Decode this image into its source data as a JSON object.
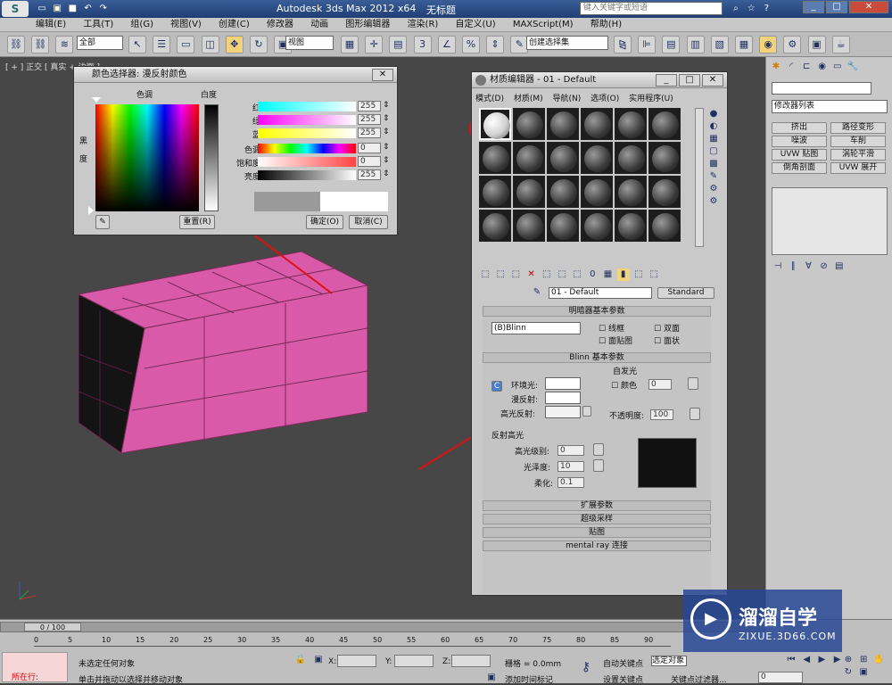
{
  "window": {
    "title": "Autodesk 3ds Max  2012 x64",
    "doc": "无标题",
    "search_placeholder": "键入关键字或短语"
  },
  "menu": [
    "编辑(E)",
    "工具(T)",
    "组(G)",
    "视图(V)",
    "创建(C)",
    "修改器",
    "动画",
    "图形编辑器",
    "渲染(R)",
    "自定义(U)",
    "MAXScript(M)",
    "帮助(H)"
  ],
  "toolbar": {
    "filter": "全部",
    "view": "视图",
    "snap_num": "3",
    "selection_set": "创建选择集"
  },
  "viewport": {
    "label": "[ + ] 正交 [ 真实 + 边面 ]"
  },
  "color_picker": {
    "title": "颜色选择器: 漫反射颜色",
    "hue_label": "色调",
    "white_label": "白度",
    "black_label": "黑",
    "degree_label": "度",
    "channels": [
      {
        "label": "红:",
        "value": "255"
      },
      {
        "label": "绿:",
        "value": "255"
      },
      {
        "label": "蓝:",
        "value": "255"
      },
      {
        "label": "色调:",
        "value": "0"
      },
      {
        "label": "饱和度:",
        "value": "0"
      },
      {
        "label": "亮度:",
        "value": "255"
      }
    ],
    "reset": "重置(R)",
    "ok": "确定(O)",
    "cancel": "取消(C)"
  },
  "material_editor": {
    "title": "材质编辑器 - 01 - Default",
    "menus": [
      "模式(D)",
      "材质(M)",
      "导航(N)",
      "选项(O)",
      "实用程序(U)"
    ],
    "material_name": "01 - Default",
    "material_type": "Standard",
    "shader_rollout": "明暗器基本参数",
    "shader": "(B)Blinn",
    "opt_wire": "线框",
    "opt_2side": "双面",
    "opt_facemap": "面贴图",
    "opt_faceted": "面状",
    "blinn_rollout": "Blinn 基本参数",
    "self_illum": "自发光",
    "ambient": "环境光:",
    "diffuse": "漫反射:",
    "specular": "高光反射:",
    "color_label": "颜色",
    "color_value": "0",
    "opacity_label": "不透明度:",
    "opacity_value": "100",
    "spec_group": "反射高光",
    "spec_level": "高光级别:",
    "spec_level_value": "0",
    "glossiness": "光泽度:",
    "glossiness_value": "10",
    "soften": "柔化:",
    "soften_value": "0.1",
    "rollouts": [
      "扩展参数",
      "超级采样",
      "贴图",
      "mental ray 连接"
    ]
  },
  "command_panel": {
    "modifier_list": "修改器列表",
    "buttons": [
      "挤出",
      "路径变形",
      "噪波",
      "车削",
      "UVW 贴图",
      "涡轮平滑",
      "倒角剖面",
      "UVW 展开"
    ]
  },
  "status": {
    "time": "0 / 100",
    "ticks": [
      "0",
      "5",
      "10",
      "15",
      "20",
      "25",
      "30",
      "35",
      "40",
      "45",
      "50",
      "55",
      "60",
      "65",
      "70",
      "75",
      "80",
      "85",
      "90"
    ],
    "location": "所在行:",
    "none_selected": "未选定任何对象",
    "hint": "单击并拖动以选择并移动对象",
    "x_label": "X:",
    "y_label": "Y:",
    "z_label": "Z:",
    "grid": "栅格 = 0.0mm",
    "add_time_tag": "添加时间标记",
    "auto_key": "自动关键点",
    "selected": "选定对象",
    "set_key": "设置关键点",
    "key_filters": "关键点过滤器...",
    "frame": "0"
  },
  "watermark": {
    "name": "溜溜自学",
    "url": "ZIXUE.3D66.COM"
  },
  "colors": {
    "box": "#d85aa8",
    "box_dark": "#1a1a1a",
    "annotation": "#e01010",
    "viewport": "#474747"
  }
}
